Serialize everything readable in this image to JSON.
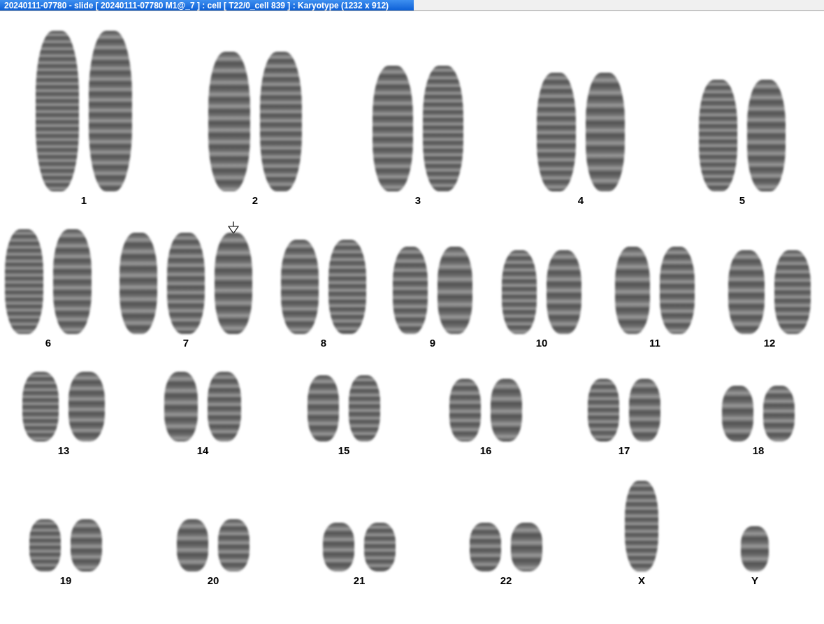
{
  "window": {
    "title": "20240111-07780 - slide [ 20240111-07780 M1@_7 ] : cell [ T22/0_cell 839 ] : Karyotype  (1232 x 912)"
  },
  "rows": [
    {
      "groups": [
        {
          "label": "1",
          "chromosomes": [
            {
              "marked": false
            },
            {
              "marked": false
            }
          ]
        },
        {
          "label": "2",
          "chromosomes": [
            {
              "marked": false
            },
            {
              "marked": false
            }
          ]
        },
        {
          "label": "3",
          "chromosomes": [
            {
              "marked": false
            },
            {
              "marked": false
            }
          ]
        },
        {
          "label": "4",
          "chromosomes": [
            {
              "marked": false
            },
            {
              "marked": false
            }
          ]
        },
        {
          "label": "5",
          "chromosomes": [
            {
              "marked": false
            },
            {
              "marked": false
            }
          ]
        }
      ]
    },
    {
      "groups": [
        {
          "label": "6",
          "chromosomes": [
            {
              "marked": false
            },
            {
              "marked": false
            }
          ]
        },
        {
          "label": "7",
          "chromosomes": [
            {
              "marked": false
            },
            {
              "marked": false
            },
            {
              "marked": true
            }
          ]
        },
        {
          "label": "8",
          "chromosomes": [
            {
              "marked": false
            },
            {
              "marked": false
            }
          ]
        },
        {
          "label": "9",
          "chromosomes": [
            {
              "marked": false
            },
            {
              "marked": false
            }
          ]
        },
        {
          "label": "10",
          "chromosomes": [
            {
              "marked": false
            },
            {
              "marked": false
            }
          ]
        },
        {
          "label": "11",
          "chromosomes": [
            {
              "marked": false
            },
            {
              "marked": false
            }
          ]
        },
        {
          "label": "12",
          "chromosomes": [
            {
              "marked": false
            },
            {
              "marked": false
            }
          ]
        }
      ]
    },
    {
      "groups": [
        {
          "label": "13",
          "chromosomes": [
            {
              "marked": false
            },
            {
              "marked": false
            }
          ]
        },
        {
          "label": "14",
          "chromosomes": [
            {
              "marked": false
            },
            {
              "marked": false
            }
          ]
        },
        {
          "label": "15",
          "chromosomes": [
            {
              "marked": false
            },
            {
              "marked": false
            }
          ]
        },
        {
          "label": "16",
          "chromosomes": [
            {
              "marked": false
            },
            {
              "marked": false
            }
          ]
        },
        {
          "label": "17",
          "chromosomes": [
            {
              "marked": false
            },
            {
              "marked": false
            }
          ]
        },
        {
          "label": "18",
          "chromosomes": [
            {
              "marked": false
            },
            {
              "marked": false
            }
          ]
        }
      ]
    },
    {
      "groups": [
        {
          "label": "19",
          "chromosomes": [
            {
              "marked": false
            },
            {
              "marked": false
            }
          ]
        },
        {
          "label": "20",
          "chromosomes": [
            {
              "marked": false
            },
            {
              "marked": false
            }
          ]
        },
        {
          "label": "21",
          "chromosomes": [
            {
              "marked": false
            },
            {
              "marked": false
            }
          ]
        },
        {
          "label": "22",
          "chromosomes": [
            {
              "marked": false
            },
            {
              "marked": false
            }
          ]
        },
        {
          "label": "X",
          "chromosomes": [
            {
              "marked": false
            }
          ]
        },
        {
          "label": "Y",
          "chromosomes": [
            {
              "marked": false
            }
          ]
        }
      ]
    }
  ]
}
